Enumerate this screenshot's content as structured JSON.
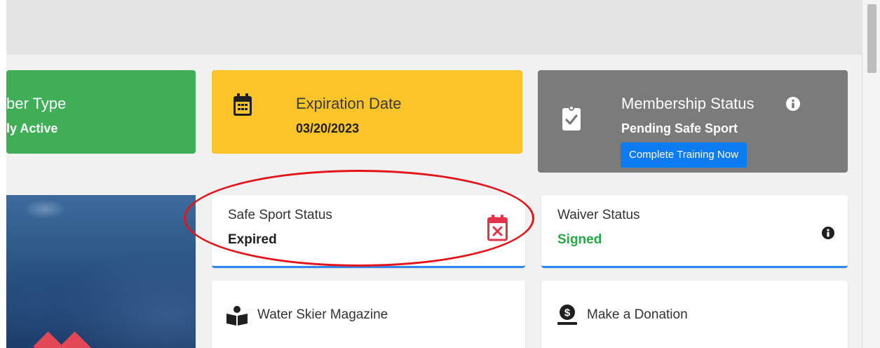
{
  "tiles": {
    "member_type": {
      "label": "Member Type",
      "visible_label": "ber Type",
      "value": "Family Active",
      "visible_value": "ly Active",
      "color": "#3fae57"
    },
    "expiration": {
      "label": "Expiration Date",
      "value": "03/20/2023",
      "icon": "calendar-icon",
      "color": "#fdc52a"
    },
    "membership_status": {
      "label": "Membership Status",
      "value": "Pending Safe Sport",
      "button_label": "Complete Training Now",
      "icon": "clipboard-check-icon",
      "info_icon": "info-icon",
      "color": "#7b7b7b"
    }
  },
  "cards": {
    "safe_sport": {
      "label": "Safe Sport Status",
      "value": "Expired",
      "icon": "calendar-x-icon",
      "status_color": "#e2334a"
    },
    "waiver": {
      "label": "Waiver Status",
      "value": "Signed",
      "value_color": "#28a745",
      "icon": "info-icon"
    },
    "magazine": {
      "label": "Water Skier Magazine",
      "icon": "reader-icon"
    },
    "donation": {
      "label": "Make a Donation",
      "icon": "donate-icon"
    }
  },
  "colors": {
    "accent_blue": "#0d7cf2",
    "underline_blue": "#2f86f1",
    "annotation_red": "#e3141a"
  }
}
